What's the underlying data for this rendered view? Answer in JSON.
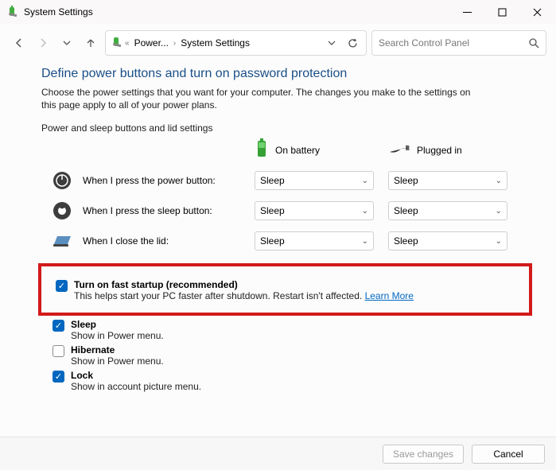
{
  "window": {
    "title": "System Settings"
  },
  "breadcrumb": {
    "level1": "Power...",
    "level2": "System Settings"
  },
  "search": {
    "placeholder": "Search Control Panel"
  },
  "page": {
    "heading": "Define power buttons and turn on password protection",
    "description": "Choose the power settings that you want for your computer. The changes you make to the settings on this page apply to all of your power plans.",
    "section1": "Power and sleep buttons and lid settings"
  },
  "columns": {
    "battery": "On battery",
    "plugged": "Plugged in"
  },
  "rows": {
    "power": {
      "label": "When I press the power button:",
      "battery": "Sleep",
      "plugged": "Sleep"
    },
    "sleep": {
      "label": "When I press the sleep button:",
      "battery": "Sleep",
      "plugged": "Sleep"
    },
    "lid": {
      "label": "When I close the lid:",
      "battery": "Sleep",
      "plugged": "Sleep"
    }
  },
  "shutdown": {
    "fast": {
      "title": "Turn on fast startup (recommended)",
      "desc": "This helps start your PC faster after shutdown. Restart isn't affected. ",
      "link": "Learn More"
    },
    "sleep": {
      "title": "Sleep",
      "desc": "Show in Power menu."
    },
    "hiber": {
      "title": "Hibernate",
      "desc": "Show in Power menu."
    },
    "lock": {
      "title": "Lock",
      "desc": "Show in account picture menu."
    }
  },
  "footer": {
    "save": "Save changes",
    "cancel": "Cancel"
  }
}
